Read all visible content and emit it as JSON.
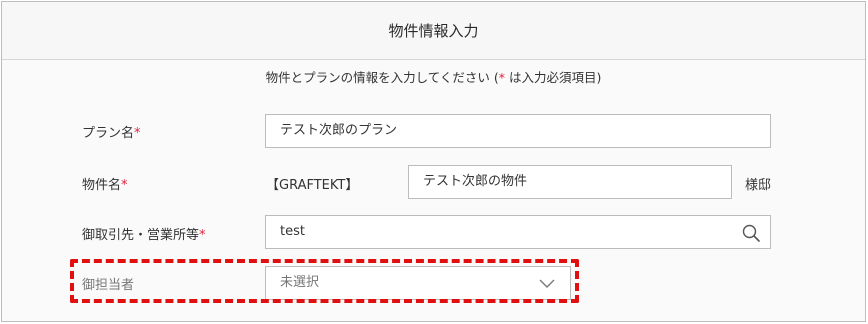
{
  "form": {
    "title": "物件情報入力",
    "subtitle_main": "物件とプランの情報を入力してください (",
    "subtitle_required_mark": "*",
    "subtitle_tail": " は入力必須項目)"
  },
  "fields": {
    "plan": {
      "label": "プラン名",
      "required_mark": "*",
      "value": "テスト次郎のプラン"
    },
    "property": {
      "label": "物件名",
      "required_mark": "*",
      "prefix": "【GRAFTEKT】",
      "value": "テスト次郎の物件",
      "suffix": "様邸"
    },
    "client": {
      "label": "御取引先・営業所等",
      "required_mark": "*",
      "value": "test",
      "icon": "search-icon"
    },
    "assignee": {
      "label": "御担当者",
      "selected": "未選択",
      "icon": "chevron-down-icon"
    }
  },
  "colors": {
    "required": "#e0223a",
    "highlight": "#e01010"
  }
}
